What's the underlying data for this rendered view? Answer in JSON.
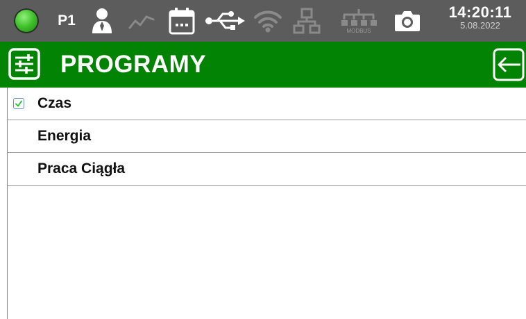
{
  "status_bar": {
    "profile": "P1",
    "modbus_label": "MODBUS",
    "time": "14:20:11",
    "date": "5.08.2022",
    "icons": [
      "status-led",
      "user-icon",
      "trend-icon",
      "calendar-icon",
      "usb-icon",
      "wifi-icon",
      "network-icon",
      "modbus-icon",
      "camera-icon"
    ],
    "colors": {
      "background": "#5c5c5c",
      "led": "#3ec02a",
      "icon_active": "#ffffff",
      "icon_inactive": "#8a8a8a"
    }
  },
  "header": {
    "title": "PROGRAMY",
    "icon": "sliders-icon",
    "back_icon": "back-arrow-icon",
    "color": "#038303"
  },
  "programs": [
    {
      "label": "Czas",
      "checked": true
    },
    {
      "label": "Energia",
      "checked": false
    },
    {
      "label": "Praca Ciągła",
      "checked": false
    }
  ],
  "check_color": "#20c020"
}
